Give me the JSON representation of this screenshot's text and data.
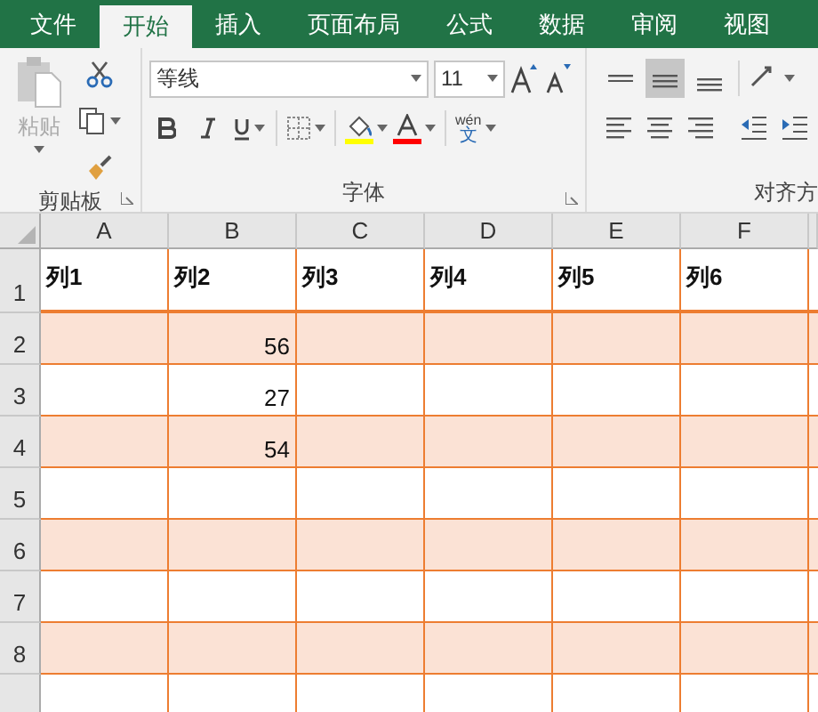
{
  "tabs": [
    {
      "label": "文件",
      "selected": false
    },
    {
      "label": "开始",
      "selected": true
    },
    {
      "label": "插入",
      "selected": false
    },
    {
      "label": "页面布局",
      "selected": false
    },
    {
      "label": "公式",
      "selected": false
    },
    {
      "label": "数据",
      "selected": false
    },
    {
      "label": "审阅",
      "selected": false
    },
    {
      "label": "视图",
      "selected": false
    }
  ],
  "clipboard": {
    "paste_label": "粘贴",
    "group_label": "剪贴板"
  },
  "font": {
    "font_name": "等线",
    "font_size": "11",
    "phonetic_top": "wén",
    "phonetic_bottom": "文",
    "group_label": "字体"
  },
  "alignment": {
    "group_label": "对齐方",
    "vertical": [
      {
        "kind": "top",
        "selected": false
      },
      {
        "kind": "middle",
        "selected": true
      },
      {
        "kind": "bottom",
        "selected": false
      }
    ]
  },
  "sheet": {
    "columns": [
      "A",
      "B",
      "C",
      "D",
      "E",
      "F"
    ],
    "rows": [
      {
        "number": "1",
        "shaded": false,
        "header": true,
        "cells": [
          "列1",
          "列2",
          "列3",
          "列4",
          "列5",
          "列6"
        ]
      },
      {
        "number": "2",
        "shaded": true,
        "header": false,
        "cells": [
          "",
          "56",
          "",
          "",
          "",
          ""
        ]
      },
      {
        "number": "3",
        "shaded": false,
        "header": false,
        "cells": [
          "",
          "27",
          "",
          "",
          "",
          ""
        ]
      },
      {
        "number": "4",
        "shaded": true,
        "header": false,
        "cells": [
          "",
          "54",
          "",
          "",
          "",
          ""
        ]
      },
      {
        "number": "5",
        "shaded": false,
        "header": false,
        "cells": [
          "",
          "",
          "",
          "",
          "",
          ""
        ]
      },
      {
        "number": "6",
        "shaded": true,
        "header": false,
        "cells": [
          "",
          "",
          "",
          "",
          "",
          ""
        ]
      },
      {
        "number": "7",
        "shaded": false,
        "header": false,
        "cells": [
          "",
          "",
          "",
          "",
          "",
          ""
        ]
      },
      {
        "number": "8",
        "shaded": true,
        "header": false,
        "cells": [
          "",
          "",
          "",
          "",
          "",
          ""
        ]
      }
    ]
  }
}
